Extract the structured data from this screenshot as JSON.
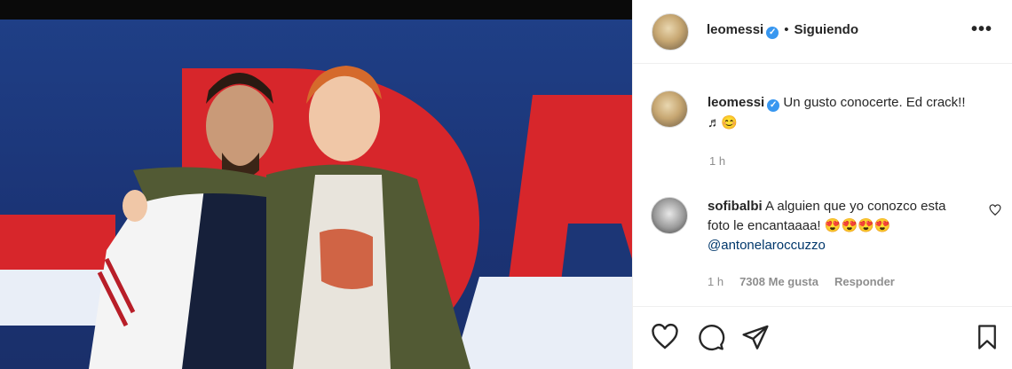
{
  "post": {
    "author": "leomessi",
    "follow_status": "Siguiendo",
    "more_label": "•••",
    "caption": {
      "username": "leomessi",
      "text": "Un gusto conocerte. Ed crack!! ♬😊",
      "time": "1 h"
    },
    "comment": {
      "username": "sofibalbi",
      "text_before": "A alguien que yo conozco esta foto le encantaaaa! 😍😍😍😍 ",
      "mention": "@antonelaroccuzzo",
      "time": "1 h",
      "likes": "7308 Me gusta",
      "reply": "Responder"
    }
  },
  "icons": {
    "like": "heart-icon",
    "comment": "comment-icon",
    "share": "paper-plane-icon",
    "save": "bookmark-icon",
    "verified": "verified-badge-icon",
    "comment_like": "heart-outline-icon"
  },
  "colors": {
    "verified": "#3897f0",
    "secondary_text": "#8e8e8e",
    "mention": "#00376b"
  }
}
